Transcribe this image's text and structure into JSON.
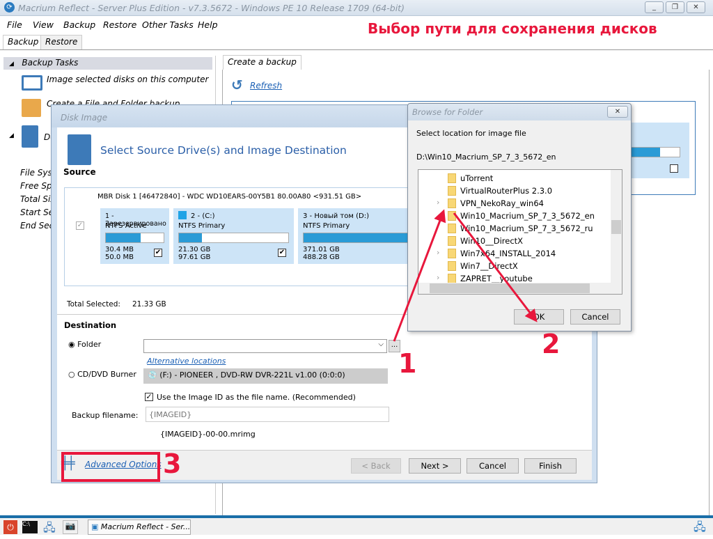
{
  "window": {
    "title": "Macrium Reflect - Server Plus Edition - v7.3.5672 - Windows PE 10 Release 1709 (64-bit)"
  },
  "menu": [
    "File",
    "View",
    "Backup",
    "Restore",
    "Other Tasks",
    "Help"
  ],
  "tabs": [
    "Backup",
    "Restore"
  ],
  "left": {
    "header": "Backup Tasks",
    "items": [
      "Image selected disks on this computer",
      "Create a File and Folder backup",
      "De"
    ],
    "props": [
      "File Syste",
      "Free Spa",
      "Total Size",
      "Start Sec",
      "End Secto"
    ]
  },
  "right": {
    "tab": "Create a backup",
    "refresh": "Refresh"
  },
  "disk_dialog": {
    "title": "Disk Image",
    "heading": "Select Source Drive(s) and Image Destination",
    "source_label": "Source",
    "disk_name": "MBR Disk 1 [46472840] - WDC WD10EARS-00Y5B1 80.00A80  <931.51 GB>",
    "partitions": [
      {
        "name": "1 - Зарезервировано",
        "type": "NTFS Active",
        "used": "30.4 MB",
        "total": "50.0 MB",
        "fill": 0.6,
        "checked": true
      },
      {
        "name": "2 -  (C:)",
        "type": "NTFS Primary",
        "used": "21.30 GB",
        "total": "97.61 GB",
        "fill": 0.21,
        "checked": true
      },
      {
        "name": "3 - Новый том (D:)",
        "type": "NTFS Primary",
        "used": "371.01 GB",
        "total": "488.28 GB",
        "fill": 0.76,
        "checked": false
      }
    ],
    "total_selected_label": "Total Selected:",
    "total_selected": "21.33 GB",
    "destination_label": "Destination",
    "folder_label": "Folder",
    "folder_value": "",
    "browse_btn": "...",
    "alt_locations": "Alternative locations",
    "cd_label": "CD/DVD Burner",
    "cd_value": "(F:) - PIONEER , DVD-RW  DVR-221L v1.00 (0:0:0)",
    "use_imageid": "Use the Image ID as the file name.  (Recommended)",
    "backup_filename_label": "Backup filename:",
    "backup_filename_placeholder": "{IMAGEID}",
    "filename_preview": "{IMAGEID}-00-00.mrimg",
    "advanced": "Advanced Options",
    "buttons": {
      "back": "< Back",
      "next": "Next >",
      "cancel": "Cancel",
      "finish": "Finish"
    }
  },
  "browse": {
    "title": "Browse for Folder",
    "prompt": "Select location for image file",
    "path": "D:\\Win10_Macrium_SP_7_3_5672_en",
    "items": [
      {
        "name": "uTorrent",
        "exp": false
      },
      {
        "name": "VirtualRouterPlus 2.3.0",
        "exp": false
      },
      {
        "name": "VPN_NekoRay_win64",
        "exp": true
      },
      {
        "name": "Win10_Macrium_SP_7_3_5672_en",
        "exp": false
      },
      {
        "name": "Win10_Macrium_SP_7_3_5672_ru",
        "exp": false
      },
      {
        "name": "Win10__DirectX",
        "exp": false
      },
      {
        "name": "Win7x64_INSTALL_2014",
        "exp": true
      },
      {
        "name": "Win7__DirectX",
        "exp": false
      },
      {
        "name": "ZAPRET__youtube",
        "exp": true
      }
    ],
    "ok": "OK",
    "cancel": "Cancel"
  },
  "annotation": {
    "title": "Выбор пути для сохранения дисков",
    "n1": "1",
    "n2": "2",
    "n3": "3",
    "color": "#e8173c"
  },
  "taskbar": {
    "app": "Macrium Reflect - Ser..."
  }
}
